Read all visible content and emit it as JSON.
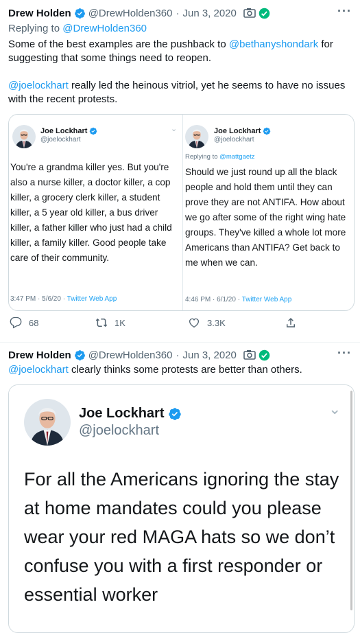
{
  "tweet1": {
    "name": "Drew Holden",
    "handle": "@DrewHolden360",
    "sep": "·",
    "date": "Jun 3, 2020",
    "replying_prefix": "Replying to",
    "replying_handle": "@DrewHolden360",
    "para1_a": "Some of the best examples are the pushback to",
    "para1_mention": "@bethanyshondark",
    "para1_b": "for suggesting that some things need to reopen.",
    "para2_mention": "@joelockhart",
    "para2_b": "really led the heinous vitriol, yet he seems to have no issues with the recent protests.",
    "more": "···",
    "shot_left": {
      "name": "Joe Lockhart",
      "handle": "@joelockhart",
      "text": "You're a grandma killer yes. But you're also a nurse killer, a doctor killer, a cop killer, a grocery clerk killer, a student killer, a 5 year old killer, a bus driver killer, a father killer who just had a child killer, a family killer. Good people take care of their community.",
      "time": "3:47 PM · 5/6/20 ·",
      "app": "Twitter Web App"
    },
    "shot_right": {
      "name": "Joe Lockhart",
      "handle": "@joelockhart",
      "replying_prefix": "Replying to",
      "replying_handle": "@mattgaetz",
      "text": "Should we just round up all the black people and hold them until they can prove they are not ANTIFA.  How about we go  after some of the right wing hate groups.  They've killed a whole lot more Americans than ANTIFA?  Get back to me when we can.",
      "time": "4:46 PM · 6/1/20 ·",
      "app": "Twitter Web App"
    },
    "actions": {
      "replies": "68",
      "retweets": "1K",
      "likes": "3.3K"
    }
  },
  "tweet2": {
    "name": "Drew Holden",
    "handle": "@DrewHolden360",
    "sep": "·",
    "date": "Jun 3, 2020",
    "mention": "@joelockhart",
    "text_b": "clearly thinks some protests are better than others.",
    "more": "···",
    "shot": {
      "name": "Joe Lockhart",
      "handle": "@joelockhart",
      "text": "For all the Americans ignoring the stay at home mandates could you please wear your red MAGA hats so we don’t confuse you with a first responder or essential worker"
    }
  },
  "colors": {
    "link": "#1d9bf0",
    "verified": "#1d9bf0",
    "badge_green": "#00ba7c",
    "text": "#0f1419",
    "muted": "#536471"
  },
  "icons": [
    "verified-badge-icon",
    "camera-icon",
    "check-badge-icon",
    "more-icon",
    "reply-icon",
    "retweet-icon",
    "like-icon",
    "share-icon",
    "chevron-down-icon"
  ]
}
